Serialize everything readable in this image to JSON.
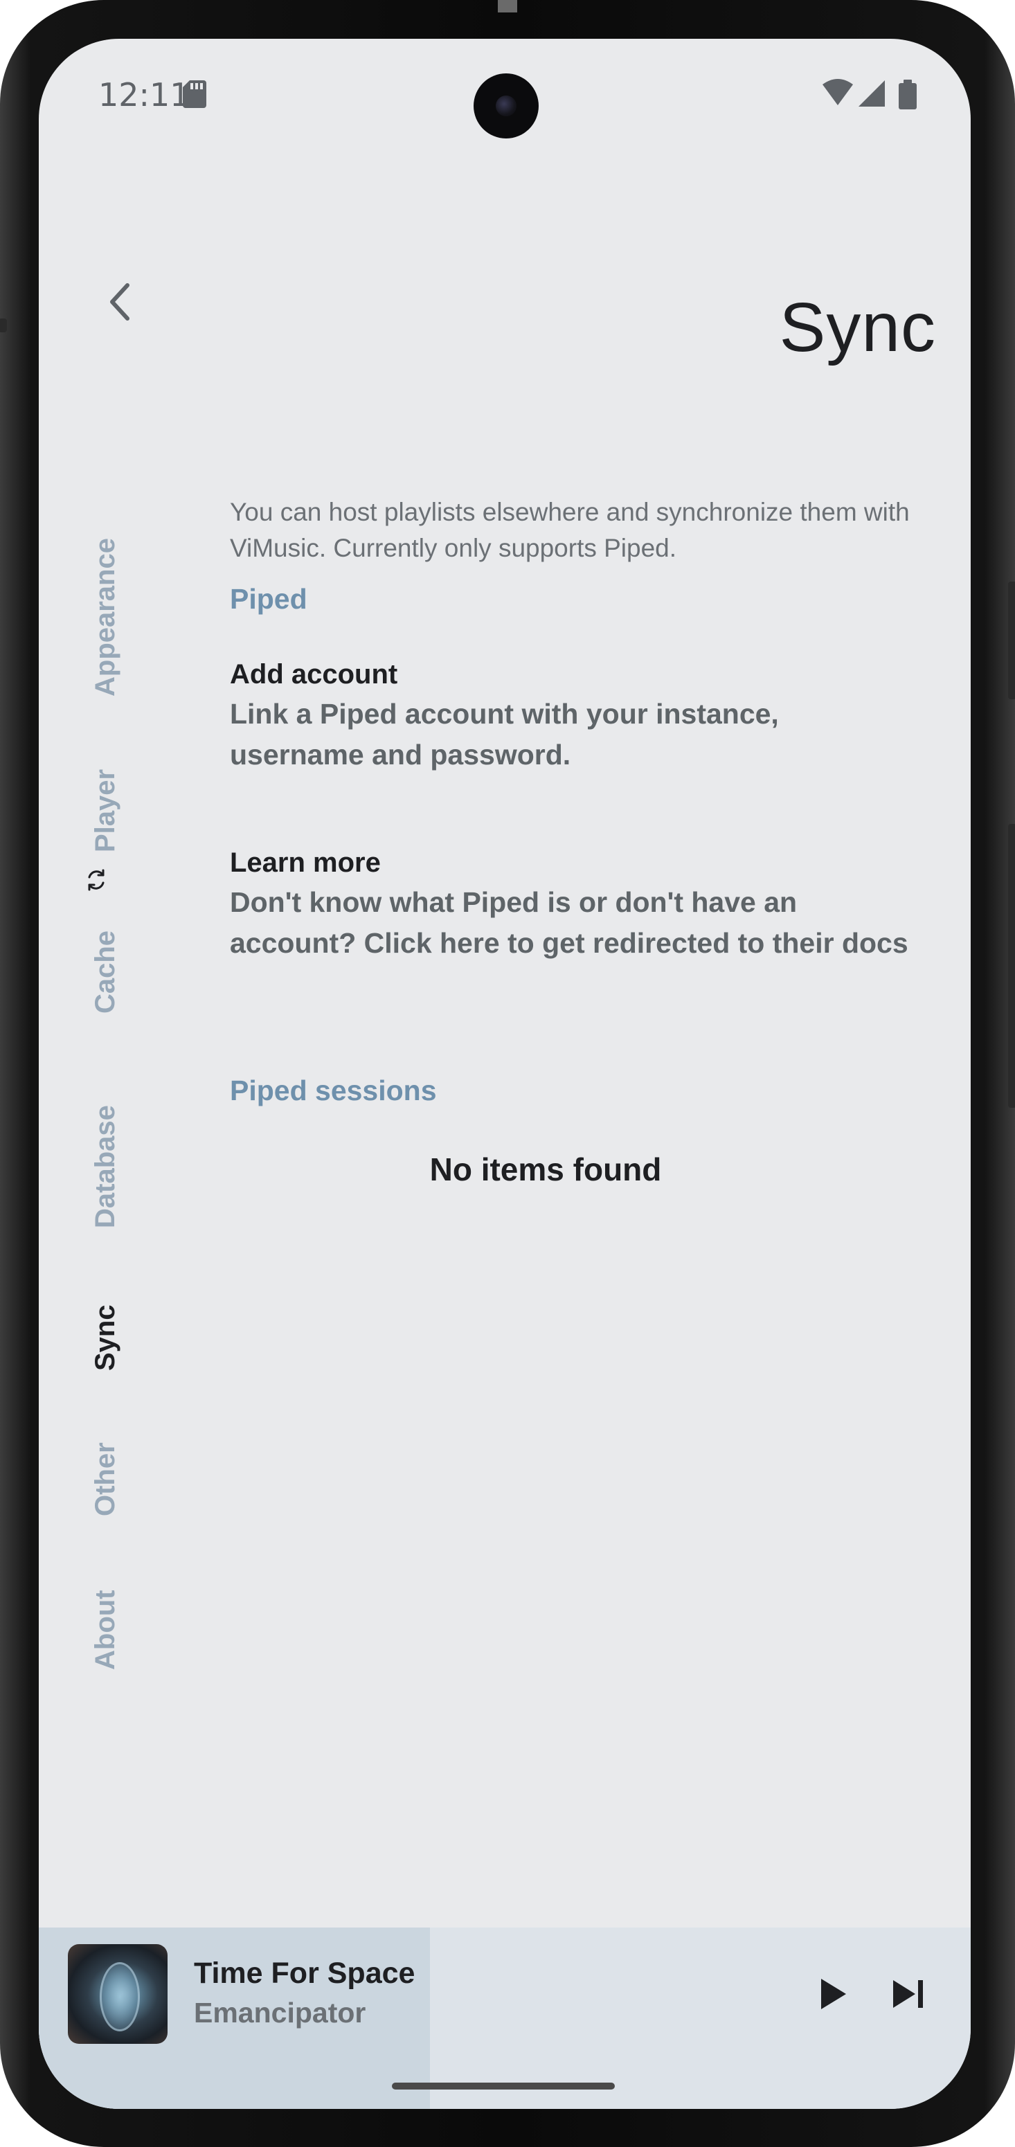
{
  "status_bar": {
    "time": "12:11"
  },
  "header": {
    "title": "Sync"
  },
  "sidebar": {
    "items": [
      {
        "label": "Appearance",
        "active": false
      },
      {
        "label": "Player",
        "active": false
      },
      {
        "label": "Cache",
        "active": false
      },
      {
        "label": "Database",
        "active": false
      },
      {
        "label": "Sync",
        "active": true
      },
      {
        "label": "Other",
        "active": false
      },
      {
        "label": "About",
        "active": false
      }
    ]
  },
  "content": {
    "intro": "You can host playlists elsewhere and synchronize them with ViMusic. Currently only supports Piped.",
    "section_piped": "Piped",
    "add_account": {
      "title": "Add account",
      "description": "Link a Piped account with your instance, username and password."
    },
    "learn_more": {
      "title": "Learn more",
      "description": "Don't know what Piped is or don't have an account? Click here to get redirected to their docs"
    },
    "section_sessions": "Piped sessions",
    "empty_state": "No items found"
  },
  "player": {
    "title": "Time For Space",
    "artist": "Emancipator",
    "progress": 0.42
  },
  "colors": {
    "background": "#e9eaec",
    "accent": "#6e90ac",
    "sidebar_inactive": "#97a8b8",
    "text_primary": "#1e1f22"
  }
}
